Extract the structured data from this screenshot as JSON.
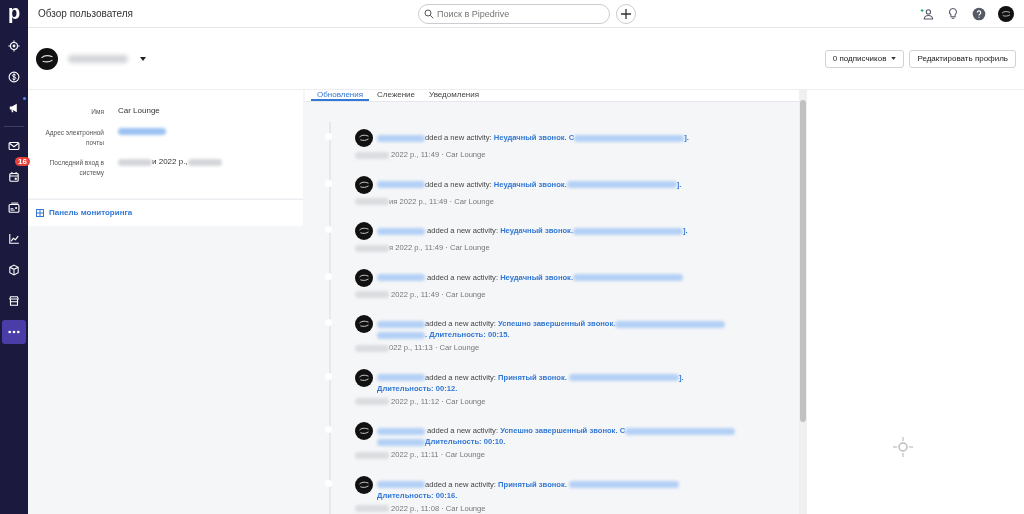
{
  "sidebar": {
    "logo": "p",
    "items": [
      {
        "selected": false
      },
      {
        "selected": false
      },
      {
        "selected": false,
        "dot": true
      },
      {
        "selected": false,
        "divider_before": true
      },
      {
        "selected": false,
        "badge": "16"
      },
      {
        "selected": false
      },
      {
        "selected": false
      },
      {
        "selected": false
      },
      {
        "selected": false
      },
      {
        "selected": true
      }
    ]
  },
  "top_bar": {
    "title": "Обзор пользователя",
    "search": {
      "placeholder": "Поиск в Pipedrive"
    }
  },
  "profile": {
    "name_blurred": true,
    "followers_button": "0 подписчиков",
    "edit_button": "Редактировать профиль"
  },
  "info": {
    "fields": [
      {
        "label": "Имя",
        "value": [
          {
            "kind": "text",
            "text": "Car Lounge"
          }
        ]
      },
      {
        "label": "Адрес электронной почты",
        "value": [
          {
            "kind": "blurlink"
          }
        ]
      },
      {
        "label": "Последний вход в систему",
        "value": [
          {
            "kind": "blur"
          },
          {
            "kind": "text",
            "text": "и 2022 р.,"
          },
          {
            "kind": "blur"
          }
        ]
      }
    ],
    "dashboard_link": "Панель мониторинга"
  },
  "tabs": [
    {
      "label": "Обновления",
      "selected": true
    },
    {
      "label": "Слежение",
      "selected": false
    },
    {
      "label": "Уведомления",
      "selected": false
    }
  ],
  "feed": [
    {
      "line": [
        {
          "kind": "blurlink"
        },
        {
          "kind": "text",
          "text": "dded a new activity: "
        },
        {
          "kind": "link",
          "text": "Неудачный звонок. С"
        },
        {
          "kind": "blurlink"
        },
        {
          "kind": "link",
          "text": "]."
        }
      ],
      "meta": [
        {
          "kind": "blur"
        },
        {
          "kind": "text",
          "text": " 2022 р., 11:49 · Car Lounge"
        }
      ]
    },
    {
      "line": [
        {
          "kind": "blurlink"
        },
        {
          "kind": "text",
          "text": "dded a new activity: "
        },
        {
          "kind": "link",
          "text": "Неудачный звонок."
        },
        {
          "kind": "blurlink"
        },
        {
          "kind": "link",
          "text": "]."
        }
      ],
      "meta": [
        {
          "kind": "blur"
        },
        {
          "kind": "text",
          "text": "ия 2022 р., 11:49 · Car Lounge"
        }
      ]
    },
    {
      "line": [
        {
          "kind": "blurlink"
        },
        {
          "kind": "text",
          "text": " added a new activity: "
        },
        {
          "kind": "link",
          "text": "Неудачный звонок."
        },
        {
          "kind": "blurlink"
        },
        {
          "kind": "link",
          "text": "]."
        }
      ],
      "meta": [
        {
          "kind": "blur"
        },
        {
          "kind": "text",
          "text": "я 2022 р., 11:49 · Car Lounge"
        }
      ]
    },
    {
      "line": [
        {
          "kind": "blurlink"
        },
        {
          "kind": "text",
          "text": " added a new activity: "
        },
        {
          "kind": "link",
          "text": "Неудачный звонок."
        },
        {
          "kind": "blurlink"
        }
      ],
      "meta": [
        {
          "kind": "blur"
        },
        {
          "kind": "text",
          "text": " 2022 р., 11:49 · Car Lounge"
        }
      ]
    },
    {
      "line": [
        {
          "kind": "blurlink"
        },
        {
          "kind": "text",
          "text": "added a new activity: "
        },
        {
          "kind": "link",
          "text": "Успешно завершенный звонок."
        },
        {
          "kind": "blurlink"
        },
        {
          "kind": "break"
        },
        {
          "kind": "blurlink"
        },
        {
          "kind": "link",
          "text": ". Длительность: 00:15."
        }
      ],
      "meta": [
        {
          "kind": "blur"
        },
        {
          "kind": "text",
          "text": "022 р., 11:13 · Car Lounge"
        }
      ]
    },
    {
      "line": [
        {
          "kind": "blurlink"
        },
        {
          "kind": "text",
          "text": "added a new activity: "
        },
        {
          "kind": "link",
          "text": "Принятый звонок. "
        },
        {
          "kind": "blurlink"
        },
        {
          "kind": "link",
          "text": "]."
        },
        {
          "kind": "break"
        },
        {
          "kind": "link",
          "text": "Длительность: 00:12."
        }
      ],
      "meta": [
        {
          "kind": "blur"
        },
        {
          "kind": "text",
          "text": " 2022 р., 11:12 · Car Lounge"
        }
      ]
    },
    {
      "line": [
        {
          "kind": "blurlink"
        },
        {
          "kind": "text",
          "text": " added a new activity: "
        },
        {
          "kind": "link",
          "text": "Успешно завершенный звонок. С"
        },
        {
          "kind": "blurlink"
        },
        {
          "kind": "break"
        },
        {
          "kind": "blurlink"
        },
        {
          "kind": "link",
          "text": "Длительность: 00:10."
        }
      ],
      "meta": [
        {
          "kind": "blur"
        },
        {
          "kind": "text",
          "text": " 2022 р., 11:11 · Car Lounge"
        }
      ]
    },
    {
      "line": [
        {
          "kind": "blurlink"
        },
        {
          "kind": "text",
          "text": "added a new activity: "
        },
        {
          "kind": "link",
          "text": "Принятый звонок. "
        },
        {
          "kind": "blurlink"
        },
        {
          "kind": "break"
        },
        {
          "kind": "link",
          "text": "Длительность: 00:16."
        }
      ],
      "meta": [
        {
          "kind": "blur"
        },
        {
          "kind": "text",
          "text": " 2022 р., 11:08 · Car Lounge"
        }
      ]
    }
  ]
}
